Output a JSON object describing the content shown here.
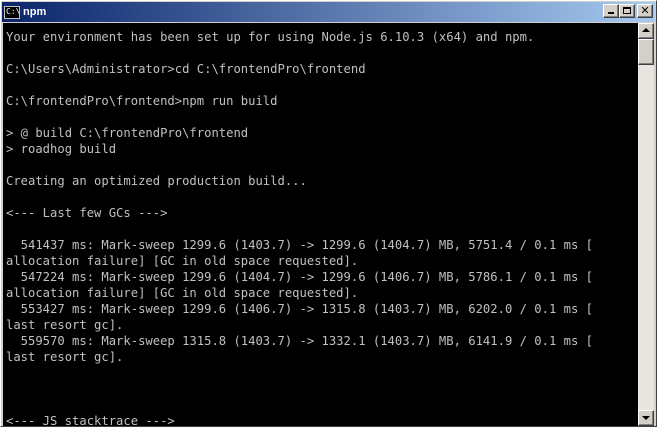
{
  "window": {
    "title": "npm",
    "icon_label": "C:\\"
  },
  "console": {
    "lines": [
      "Your environment has been set up for using Node.js 6.10.3 (x64) and npm.",
      "",
      "C:\\Users\\Administrator>cd C:\\frontendPro\\frontend",
      "",
      "C:\\frontendPro\\frontend>npm run build",
      "",
      "> @ build C:\\frontendPro\\frontend",
      "> roadhog build",
      "",
      "Creating an optimized production build...",
      "",
      "<--- Last few GCs --->",
      "",
      "  541437 ms: Mark-sweep 1299.6 (1403.7) -> 1299.6 (1404.7) MB, 5751.4 / 0.1 ms [",
      "allocation failure] [GC in old space requested].",
      "  547224 ms: Mark-sweep 1299.6 (1404.7) -> 1299.6 (1406.7) MB, 5786.1 / 0.1 ms [",
      "allocation failure] [GC in old space requested].",
      "  553427 ms: Mark-sweep 1299.6 (1406.7) -> 1315.8 (1403.7) MB, 6202.0 / 0.1 ms [",
      "last resort gc].",
      "  559570 ms: Mark-sweep 1315.8 (1403.7) -> 1332.1 (1403.7) MB, 6141.9 / 0.1 ms [",
      "last resort gc].",
      "",
      "",
      "",
      "<--- JS stacktrace --->"
    ]
  }
}
